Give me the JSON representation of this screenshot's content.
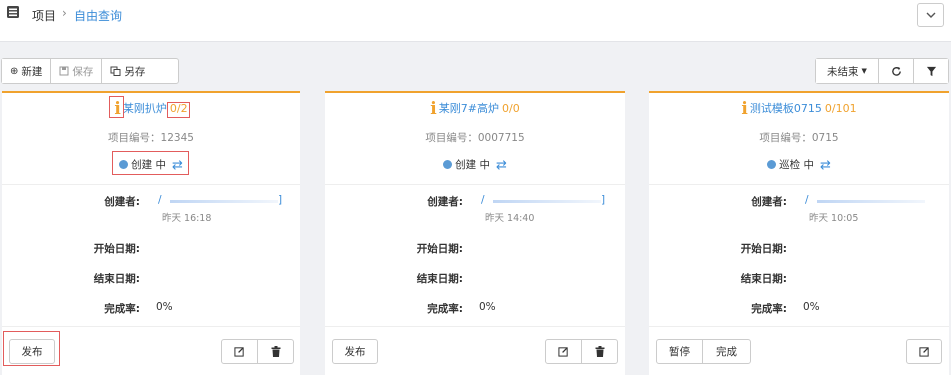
{
  "breadcrumb": {
    "root": "项目",
    "separator": "›",
    "current": "自由查询"
  },
  "toolbar": {
    "new_label": "新建",
    "save_label": "保存",
    "save_as_label": "另存",
    "filter_select": "未结束"
  },
  "fields": {
    "creator_label": "创建者:",
    "start_label": "开始日期:",
    "end_label": "结束日期:",
    "completion_label": "完成率:"
  },
  "cards": [
    {
      "title": "某刚扒炉",
      "progress": "0/2",
      "code": "项目编号：12345",
      "status": "创建 中",
      "creator_start": "/",
      "creator_end": "]",
      "created_time": "昨天 16:18",
      "completion": "0%",
      "buttons": {
        "publish": "发布"
      }
    },
    {
      "title": "某刚7#高炉",
      "progress": "0/0",
      "code": "项目编号：0007715",
      "status": "创建 中",
      "creator_start": "/",
      "creator_end": "]",
      "created_time": "昨天 14:40",
      "completion": "0%",
      "buttons": {
        "publish": "发布"
      }
    },
    {
      "title": "测试模板0715",
      "progress": "0/101",
      "code": "项目编号：0715",
      "status": "巡检 中",
      "creator_start": "/",
      "creator_end": "",
      "created_time": "昨天 10:05",
      "completion": "0%",
      "buttons": {
        "pause": "暂停",
        "complete": "完成"
      }
    }
  ],
  "colors": {
    "accent": "#f0a22e",
    "link": "#3c8dd8",
    "status_dot": "#5b9bd5",
    "highlight": "#e25c5c"
  }
}
